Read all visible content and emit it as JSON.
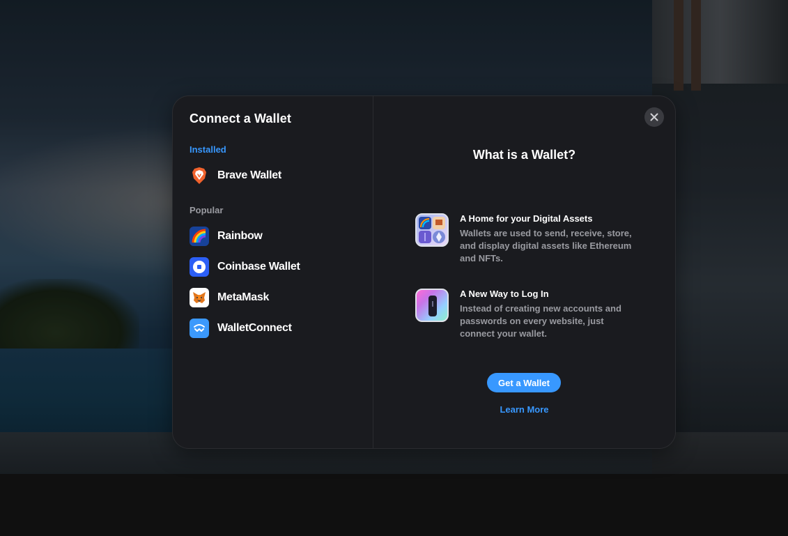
{
  "modal": {
    "title": "Connect a Wallet",
    "groups": [
      {
        "label": "Installed",
        "wallets": [
          {
            "label": "Brave Wallet",
            "icon": "brave-lion-icon",
            "color": "#f0622d"
          }
        ]
      },
      {
        "label": "Popular",
        "wallets": [
          {
            "label": "Rainbow",
            "icon": "rainbow-icon",
            "color": "#174299"
          },
          {
            "label": "Coinbase Wallet",
            "icon": "coinbase-icon",
            "color": "#2c5ff6"
          },
          {
            "label": "MetaMask",
            "icon": "metamask-fox-icon",
            "color": "#ffffff"
          },
          {
            "label": "WalletConnect",
            "icon": "walletconnect-icon",
            "color": "#3b99fc"
          }
        ]
      }
    ]
  },
  "info": {
    "title": "What is a Wallet?",
    "features": [
      {
        "title": "A Home for your Digital Assets",
        "description": "Wallets are used to send, receive, store, and display digital assets like Ethereum and NFTs.",
        "icon": "digital-assets-icon"
      },
      {
        "title": "A New Way to Log In",
        "description": "Instead of creating new accounts and passwords on every website, just connect your wallet.",
        "icon": "login-key-icon"
      }
    ],
    "get_wallet_label": "Get a Wallet",
    "learn_more_label": "Learn More"
  },
  "colors": {
    "accent": "#3898ff",
    "modal_bg": "#1a1b1f",
    "secondary_text": "#9a9ba1"
  }
}
